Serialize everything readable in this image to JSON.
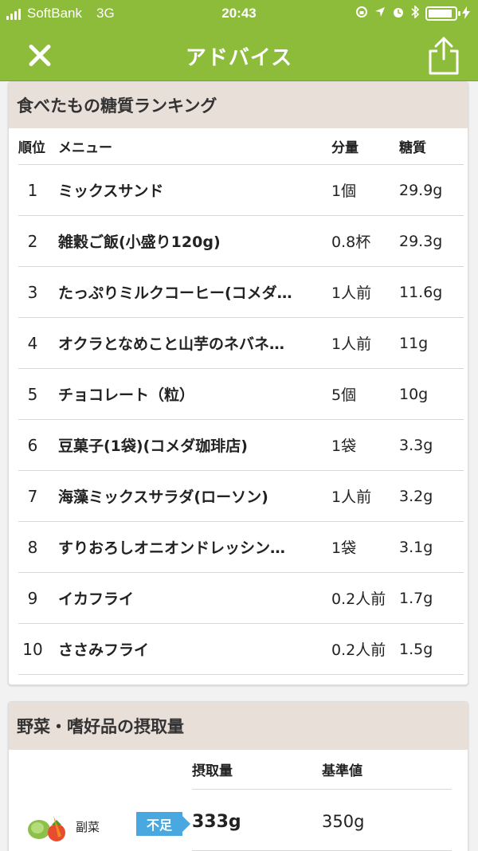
{
  "status_bar": {
    "carrier": "SoftBank",
    "network": "3G",
    "time": "20:43",
    "battery_level": 0.9
  },
  "nav": {
    "title": "アドバイス",
    "close_icon": "close-icon",
    "share_icon": "share-icon"
  },
  "ranking": {
    "title": "食べたもの糖質ランキング",
    "headers": {
      "rank": "順位",
      "menu": "メニュー",
      "amount": "分量",
      "sugar": "糖質"
    },
    "rows": [
      {
        "rank": "1",
        "menu": "ミックスサンド",
        "amount": "1個",
        "sugar": "29.9g"
      },
      {
        "rank": "2",
        "menu": "雑穀ご飯(小盛り120g)",
        "amount": "0.8杯",
        "sugar": "29.3g"
      },
      {
        "rank": "3",
        "menu": "たっぷりミルクコーヒー(コメダ…",
        "amount": "1人前",
        "sugar": "11.6g"
      },
      {
        "rank": "4",
        "menu": "オクラとなめこと山芋のネバネ…",
        "amount": "1人前",
        "sugar": "11g"
      },
      {
        "rank": "5",
        "menu": "チョコレート（粒）",
        "amount": "5個",
        "sugar": "10g"
      },
      {
        "rank": "6",
        "menu": "豆菓子(1袋)(コメダ珈琲店)",
        "amount": "1袋",
        "sugar": "3.3g"
      },
      {
        "rank": "7",
        "menu": "海藻ミックスサラダ(ローソン)",
        "amount": "1人前",
        "sugar": "3.2g"
      },
      {
        "rank": "8",
        "menu": "すりおろしオニオンドレッシン…",
        "amount": "1袋",
        "sugar": "3.1g"
      },
      {
        "rank": "9",
        "menu": "イカフライ",
        "amount": "0.2人前",
        "sugar": "1.7g"
      },
      {
        "rank": "10",
        "menu": "ささみフライ",
        "amount": "0.2人前",
        "sugar": "1.5g"
      }
    ]
  },
  "vegetables": {
    "title": "野菜・嗜好品の摂取量",
    "headers": {
      "intake": "摂取量",
      "standard": "基準値"
    },
    "items": [
      {
        "label": "副菜",
        "status": "不足",
        "intake": "333g",
        "standard": "350g",
        "icon": "vegetables-icon"
      }
    ]
  },
  "colors": {
    "brand_green": "#8dbb3a",
    "header_beige": "#e8dfd9",
    "badge_blue": "#4aa8e0"
  }
}
